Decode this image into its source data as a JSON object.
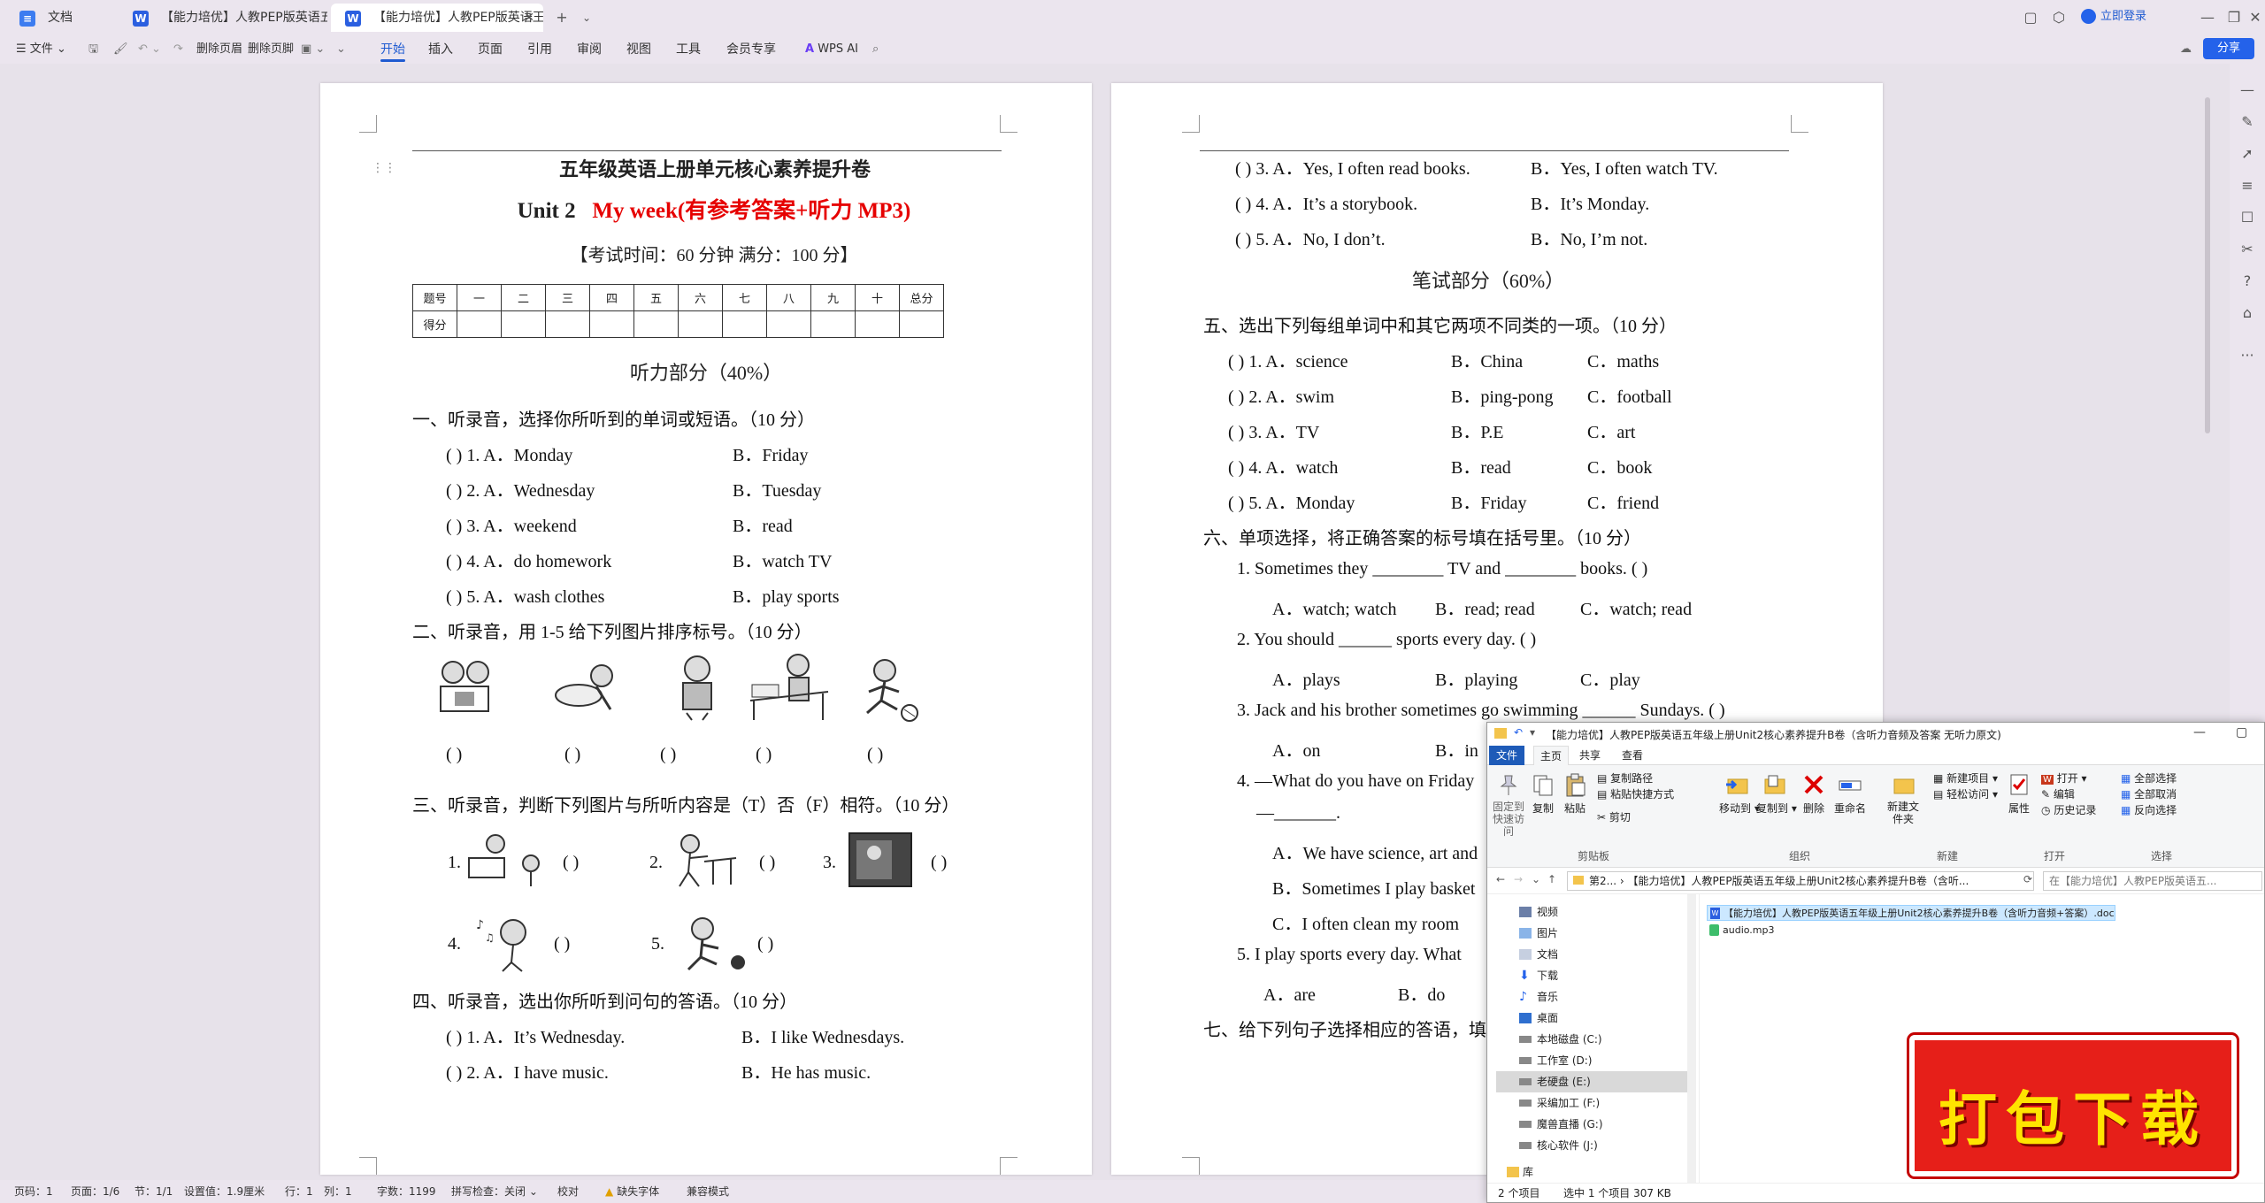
{
  "tabs": [
    {
      "label": "文档",
      "icon": "docs-icon"
    },
    {
      "label": "【能力培优】人教PEP版英语五年级上"
    },
    {
      "label": "【能力培优】人教PEP版英语王"
    }
  ],
  "titlebar": {
    "login": "立即登录"
  },
  "toolbar": {
    "file": "文件",
    "delete_header": "删除页眉",
    "delete_footer": "删除页脚",
    "menus": [
      "开始",
      "插入",
      "页面",
      "引用",
      "审阅",
      "视图",
      "工具",
      "会员专享"
    ],
    "wps_ai": "WPS AI",
    "share": "分享"
  },
  "page1": {
    "heading": "五年级英语上册单元核心素养提升卷",
    "unit": "Unit 2",
    "unit_title": "My week(有参考答案+听力 MP3)",
    "exam_info": "【考试时间：60 分钟  满分：100 分】",
    "score_header": [
      "题号",
      "一",
      "二",
      "三",
      "四",
      "五",
      "六",
      "七",
      "八",
      "九",
      "十",
      "总分"
    ],
    "score_row_label": "得分",
    "listening_heading": "听力部分（40%）",
    "s1": "一、听录音，选择你所听到的单词或短语。（10 分）",
    "s1_items": [
      {
        "a": "(        ) 1. A．Monday",
        "b": "B．Friday"
      },
      {
        "a": "(        ) 2. A．Wednesday",
        "b": "B．Tuesday"
      },
      {
        "a": "(        ) 3. A．weekend",
        "b": "B．read"
      },
      {
        "a": "(        ) 4. A．do homework",
        "b": "B．watch TV"
      },
      {
        "a": "(        ) 5. A．wash clothes",
        "b": "B．play sports"
      }
    ],
    "s2": "二、听录音，用 1-5 给下列图片排序标号。（10 分）",
    "s2_brackets": [
      "(        )",
      "(        )",
      "(        )",
      "(        )",
      "(        )"
    ],
    "s3": "三、听录音，判断下列图片与所听内容是（T）否（F）相符。（10 分）",
    "s3_items": [
      {
        "num": "1.",
        "bracket": "(        )"
      },
      {
        "num": "2.",
        "bracket": "(        )"
      },
      {
        "num": "3.",
        "bracket": "(        )"
      },
      {
        "num": "4.",
        "bracket": "(        )"
      },
      {
        "num": "5.",
        "bracket": "(        )"
      }
    ],
    "s4": "四、听录音，选出你所听到问句的答语。（10 分）",
    "s4_items": [
      {
        "a": "(        ) 1. A．It’s Wednesday.",
        "b": "B．I like Wednesdays."
      },
      {
        "a": "(        ) 2. A．I have music.",
        "b": "B．He has music."
      }
    ]
  },
  "page2": {
    "top_items": [
      {
        "a": "(        ) 3. A．Yes, I often read books.",
        "b": "B．Yes, I often watch TV."
      },
      {
        "a": "(        ) 4. A．It’s a storybook.",
        "b": "B．It’s Monday."
      },
      {
        "a": "(        ) 5. A．No, I don’t.",
        "b": "B．No, I’m not."
      }
    ],
    "written_heading": "笔试部分（60%）",
    "s5": "五、选出下列每组单词中和其它两项不同类的一项。（10 分）",
    "s5_items": [
      {
        "a": "(        ) 1. A．science",
        "b": "B．China",
        "c": "C．maths"
      },
      {
        "a": "(        ) 2. A．swim",
        "b": "B．ping-pong",
        "c": "C．football"
      },
      {
        "a": "(        ) 3. A．TV",
        "b": "B．P.E",
        "c": "C．art"
      },
      {
        "a": "(        ) 4. A．watch",
        "b": "B．read",
        "c": "C．book"
      },
      {
        "a": "(        ) 5. A．Monday",
        "b": "B．Friday",
        "c": "C．friend"
      }
    ],
    "s6": "六、单项选择，将正确答案的标号填在括号里。（10 分）",
    "q1": "1.   Sometimes they ________ TV and ________ books. (          )",
    "q1_opts": [
      "A．watch; watch",
      "B．read; read",
      "C．watch; read"
    ],
    "q2": "2.   You should ______ sports every day. (        )",
    "q2_opts": [
      "A．plays",
      "B．playing",
      "C．play"
    ],
    "q3": "3.   Jack and his brother sometimes go swimming ______ Sundays. (        )",
    "q3_opts": [
      "A．on",
      "B．in"
    ],
    "q4": "4.   —What do you have on Friday",
    "q4_blank": "—_______.",
    "q4_opts": [
      "A．We have science, art and",
      "B．Sometimes I play basket",
      "C．I often clean my room"
    ],
    "q5": "5.    I play sports every day. What",
    "q5_opts": [
      "A．are",
      "B．do"
    ],
    "s7": "七、给下列句子选择相应的答语，填"
  },
  "status": {
    "page_num": "页码：1",
    "pages": "页面：1/6",
    "section": "节：1/1",
    "setting": "设置值：1.9厘米",
    "row": "行：1",
    "col": "列：1",
    "words": "字数：1199",
    "spell": "拼写检查：关闭",
    "proof": "校对",
    "missing_font": "缺失字体",
    "compat": "兼容模式"
  },
  "explorer": {
    "title": "【能力培优】人教PEP版英语五年级上册Unit2核心素养提升B卷（含听力音频及答案 无听力原文)",
    "tabs": [
      "文件",
      "主页",
      "共享",
      "查看"
    ],
    "ribbon": {
      "pin": "固定到快速访问",
      "copy": "复制",
      "paste": "粘贴",
      "copy_path": "复制路径",
      "paste_shortcut": "粘贴快捷方式",
      "cut": "剪切",
      "move_to": "移动到",
      "copy_to": "复制到",
      "delete": "删除",
      "rename": "重命名",
      "new_folder": "新建文件夹",
      "new_item": "新建项目",
      "easy_access": "轻松访问",
      "properties": "属性",
      "open": "打开",
      "edit": "编辑",
      "history": "历史记录",
      "select_all": "全部选择",
      "select_none": "全部取消",
      "invert": "反向选择",
      "groups": [
        "剪贴板",
        "组织",
        "新建",
        "打开",
        "选择"
      ]
    },
    "address": "第2...  ›  【能力培优】人教PEP版英语五年级上册Unit2核心素养提升B卷（含听...",
    "search_placeholder": "在【能力培优】人教PEP版英语五...",
    "nav": [
      "视频",
      "图片",
      "文档",
      "下载",
      "音乐",
      "桌面",
      "本地磁盘 (C:)",
      "工作室 (D:)",
      "老硬盘 (E:)",
      "采编加工 (F:)",
      "魔兽直播 (G:)",
      "核心软件 (J:)",
      "库"
    ],
    "files": [
      "【能力培优】人教PEP版英语五年级上册Unit2核心素养提升B卷（含听力音频+答案）.doc",
      "audio.mp3"
    ],
    "status_items": "2 个项目",
    "status_selected": "选中 1 个项目  307 KB"
  },
  "download_banner": "打包下载"
}
